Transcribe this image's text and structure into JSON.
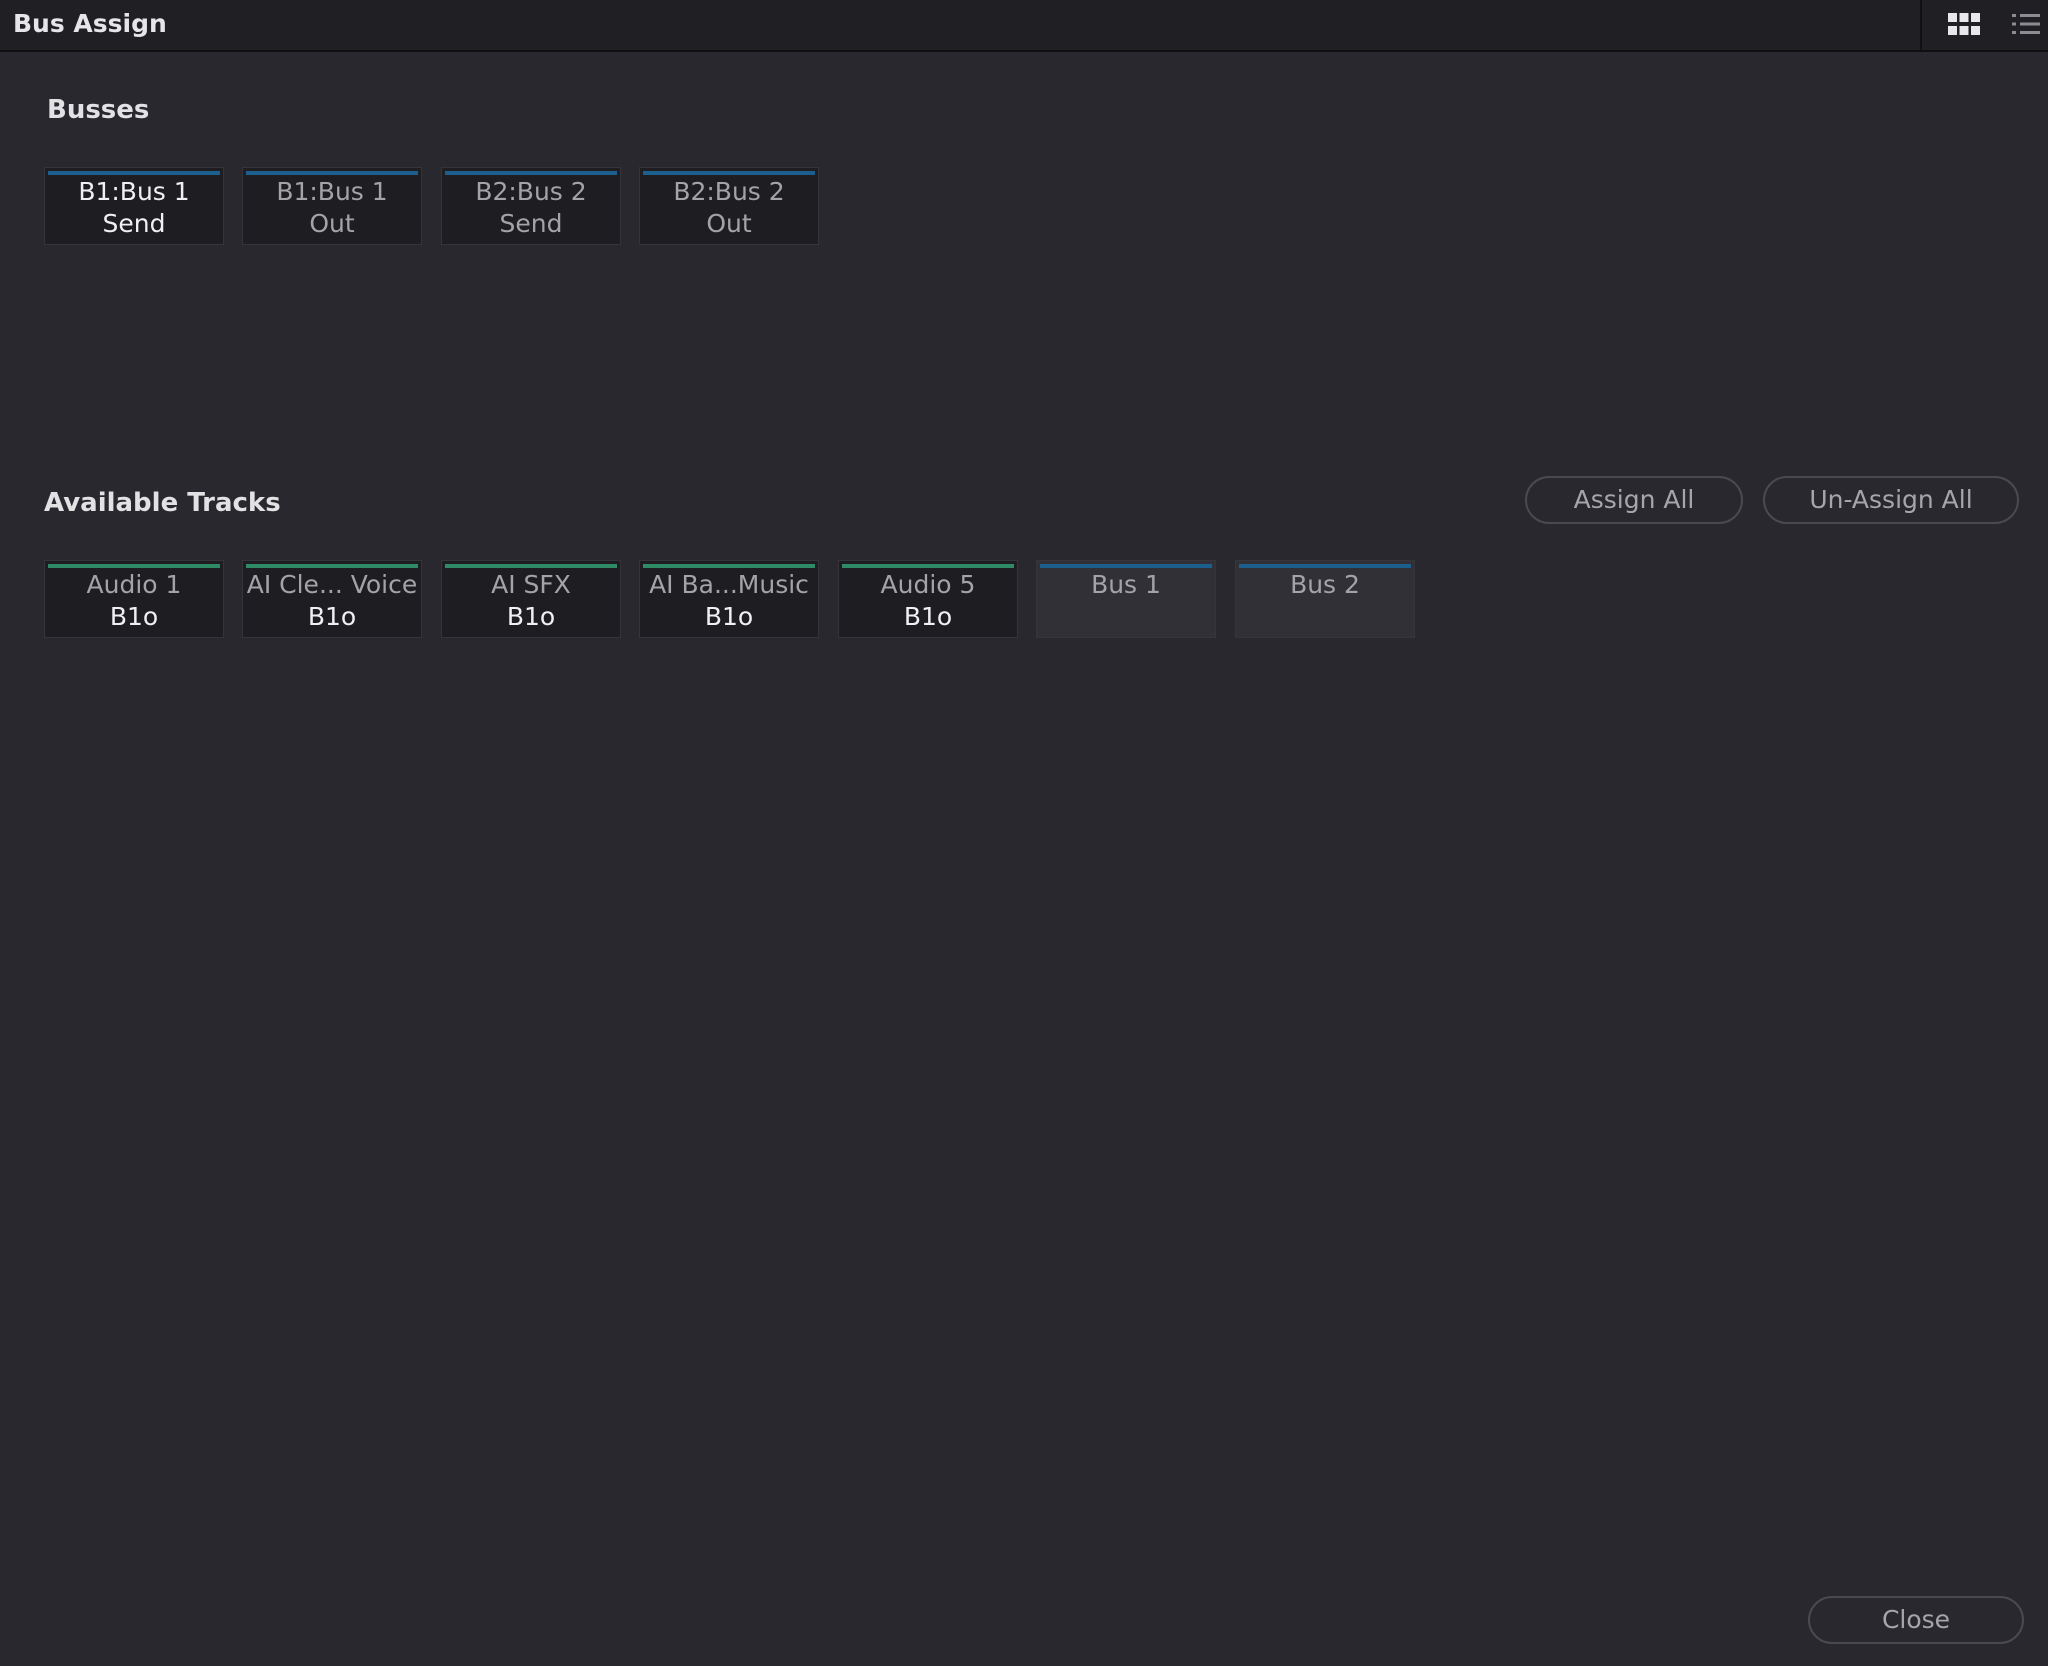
{
  "window": {
    "title": "Bus Assign"
  },
  "view_switch": {
    "grid_icon": "grid-view-icon",
    "list_icon": "list-view-icon"
  },
  "busses": {
    "title": "Busses",
    "items": [
      {
        "line1": "B1:Bus 1",
        "line2": "Send",
        "selected": true
      },
      {
        "line1": "B1:Bus 1",
        "line2": "Out",
        "selected": false
      },
      {
        "line1": "B2:Bus 2",
        "line2": "Send",
        "selected": false
      },
      {
        "line1": "B2:Bus 2",
        "line2": "Out",
        "selected": false
      }
    ]
  },
  "tracks": {
    "title": "Available Tracks",
    "assign_all_label": "Assign All",
    "unassign_all_label": "Un-Assign All",
    "items": [
      {
        "line1": "Audio 1",
        "line2": "B1o",
        "color": "#2f8a66"
      },
      {
        "line1": "AI Cle... Voice",
        "line2": "B1o",
        "color": "#2f8a66"
      },
      {
        "line1": "AI SFX",
        "line2": "B1o",
        "color": "#2f8a66"
      },
      {
        "line1": "AI Ba...Music",
        "line2": "B1o",
        "color": "#2f8a66"
      },
      {
        "line1": "Audio 5",
        "line2": "B1o",
        "color": "#2f8a66"
      },
      {
        "line1": "Bus 1",
        "line2": "",
        "color": "#1c5f8c"
      },
      {
        "line1": "Bus 2",
        "line2": "",
        "color": "#1c5f8c"
      }
    ]
  },
  "footer": {
    "close_label": "Close"
  }
}
